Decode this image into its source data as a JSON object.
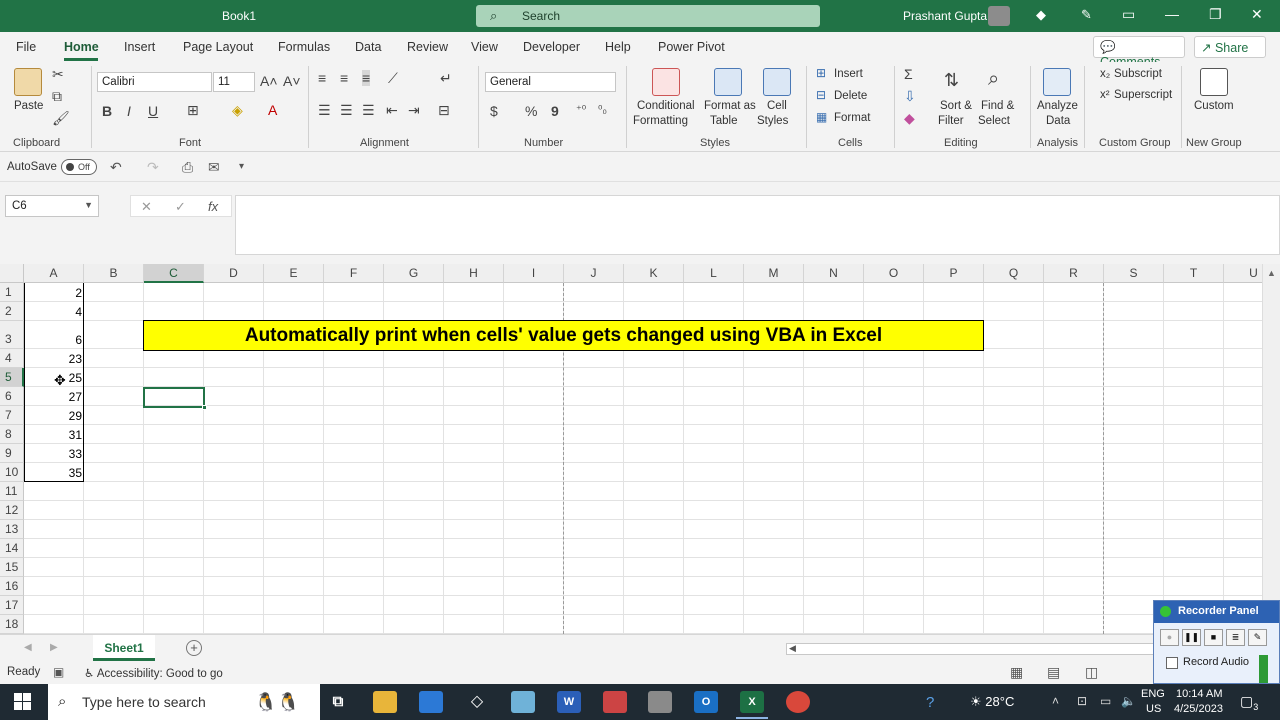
{
  "titlebar": {
    "doc_title": "Book1",
    "search_label": "Search",
    "user_name": "Prashant Gupta"
  },
  "tabs": [
    "File",
    "Home",
    "Insert",
    "Page Layout",
    "Formulas",
    "Data",
    "Review",
    "View",
    "Developer",
    "Help",
    "Power Pivot"
  ],
  "active_tab": "Home",
  "header_buttons": {
    "comments": "Comments",
    "share": "Share"
  },
  "ribbon": {
    "clipboard": {
      "paste": "Paste",
      "label": "Clipboard"
    },
    "font": {
      "name": "Calibri",
      "size": "11",
      "label": "Font",
      "bold": "B",
      "italic": "I",
      "underline": "U"
    },
    "alignment": {
      "label": "Alignment"
    },
    "number": {
      "format": "General",
      "label": "Number",
      "currency": "$",
      "percent": "%",
      "comma": "9"
    },
    "styles": {
      "conditional_formatting_1": "Conditional",
      "conditional_formatting_2": "Formatting",
      "format_as_table_1": "Format as",
      "format_as_table_2": "Table",
      "cell_styles_1": "Cell",
      "cell_styles_2": "Styles",
      "label": "Styles"
    },
    "cells": {
      "insert": "Insert",
      "delete": "Delete",
      "format": "Format",
      "label": "Cells"
    },
    "editing": {
      "sort_1": "Sort &",
      "sort_2": "Filter",
      "find_1": "Find &",
      "find_2": "Select",
      "label": "Editing"
    },
    "analysis": {
      "analyze_1": "Analyze",
      "analyze_2": "Data",
      "label": "Analysis"
    },
    "custom_group": {
      "subscript": "Subscript",
      "superscript": "Superscript",
      "label": "Custom Group"
    },
    "new_group": {
      "custom": "Custom",
      "label": "New Group"
    }
  },
  "qat": {
    "autosave": "AutoSave",
    "toggle": "Off"
  },
  "formula_bar": {
    "name_box": "C6",
    "fx": "fx",
    "cancel": "✕",
    "enter": "✓"
  },
  "grid": {
    "columns": [
      "A",
      "B",
      "C",
      "D",
      "E",
      "F",
      "G",
      "H",
      "I",
      "J",
      "K",
      "L",
      "M",
      "N",
      "O",
      "P",
      "Q",
      "R",
      "S",
      "T",
      "U"
    ],
    "rows": [
      "1",
      "2",
      "3",
      "4",
      "5",
      "6",
      "7",
      "8",
      "9",
      "10",
      "11",
      "12",
      "13",
      "14",
      "15",
      "16",
      "17",
      "18"
    ],
    "col_a_values": [
      "2",
      "4",
      "6",
      "23",
      "25",
      "27",
      "29",
      "31",
      "33",
      "35"
    ],
    "banner_text": "Automatically print when cells' value gets changed using VBA in Excel",
    "selected_column": "C",
    "selected_row": "5"
  },
  "sheet_tab": "Sheet1",
  "statusbar": {
    "ready": "Ready",
    "accessibility": "Accessibility: Good to go"
  },
  "recorder": {
    "title": "Recorder Panel",
    "record_audio": "Record Audio"
  },
  "taskbar": {
    "search_placeholder": "Type here to search",
    "weather": "28°C",
    "lang_1": "ENG",
    "lang_2": "US",
    "time": "10:14 AM",
    "date": "4/25/2023",
    "notification_count": "3"
  },
  "colors": {
    "excel_green": "#217346",
    "banner_yellow": "#ffff00",
    "taskbar": "#1f2a33"
  }
}
